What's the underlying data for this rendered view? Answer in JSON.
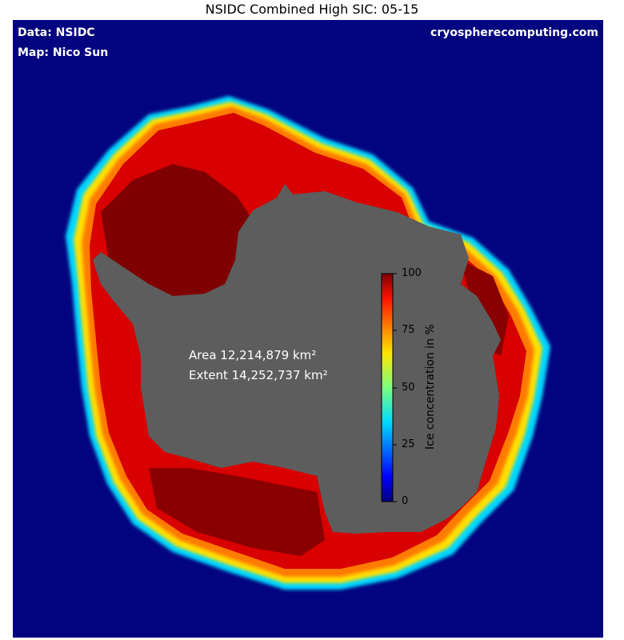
{
  "title": "NSIDC Combined High SIC: 05-15",
  "credits": {
    "data_label": "Data: NSIDC",
    "map_label": "Map: Nico Sun",
    "website": "cryospherecomputing.com"
  },
  "stats": {
    "area": "Area 12,214,879 km²",
    "extent": "Extent 14,252,737 km²"
  },
  "colorbar": {
    "title": "Ice concentration in %",
    "ticks": [
      "100",
      "75",
      "50",
      "25",
      "0"
    ],
    "colormap": "jet"
  },
  "colors": {
    "ocean": "#03047f",
    "land": "#5d5d5d",
    "high_ice": "#7f0000",
    "ice": "#d40000",
    "edge_orange": "#ff8c00",
    "edge_yellow": "#ffe000",
    "edge_cyan": "#00e0ff"
  }
}
